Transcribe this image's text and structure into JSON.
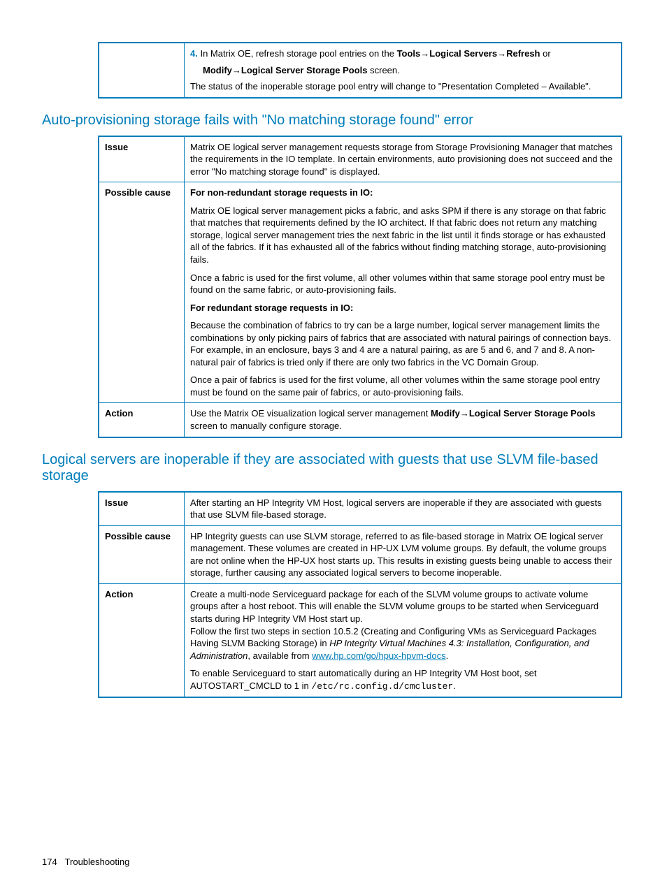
{
  "table0": {
    "step4_num": "4.",
    "step4_a": "In Matrix OE, refresh storage pool entries on the ",
    "step4_b": "Tools",
    "step4_c": "Logical Servers",
    "step4_d": "Refresh",
    "step4_e": " or ",
    "step4_f": "Modify",
    "step4_g": "Logical Server Storage Pools",
    "step4_h": " screen.",
    "step4_after": "The status of the inoperable storage pool entry will change to \"Presentation Completed – Available\"."
  },
  "heading1": "Auto-provisioning storage fails with \"No matching storage found\" error",
  "table1": {
    "issue_label": "Issue",
    "issue_text": "Matrix OE logical server management requests storage from Storage Provisioning Manager that matches the requirements in the IO template. In certain environments, auto provisioning does not succeed and the error \"No matching storage found\" is displayed.",
    "cause_label": "Possible cause",
    "cause_h1": "For non-redundant storage requests in IO:",
    "cause_p1": "Matrix OE logical server management picks a fabric, and asks SPM if there is any storage on that fabric that matches that requirements defined by the IO architect. If that fabric does not return any matching storage, logical server management tries the next fabric in the list until it finds storage or has exhausted all of the fabrics. If it has exhausted all of the fabrics without finding matching storage, auto-provisioning fails.",
    "cause_p2": "Once a fabric is used for the first volume, all other volumes within that same storage pool entry must be found on the same fabric, or auto-provisioning fails.",
    "cause_h2": "For redundant storage requests in IO:",
    "cause_p3": "Because the combination of fabrics to try can be a large number, logical server management limits the combinations by only picking pairs of fabrics that are associated with natural pairings of connection bays. For example, in an enclosure, bays 3 and 4 are a natural pairing, as are 5 and 6, and 7 and 8. A non-natural pair of fabrics is tried only if there are only two fabrics in the VC Domain Group.",
    "cause_p4": "Once a pair of fabrics is used for the first volume, all other volumes within the same storage pool entry must be found on the same pair of fabrics, or auto-provisioning fails.",
    "action_label": "Action",
    "action_a": "Use the Matrix OE visualization logical server management ",
    "action_b": "Modify",
    "action_c": "Logical Server Storage Pools",
    "action_d": " screen to manually configure storage."
  },
  "heading2": "Logical servers are inoperable if they are associated with guests that use SLVM file-based storage",
  "table2": {
    "issue_label": "Issue",
    "issue_text": "After starting an HP Integrity VM Host, logical servers are inoperable if they are associated with guests that use SLVM file-based storage.",
    "cause_label": "Possible cause",
    "cause_text": "HP Integrity guests can use SLVM storage, referred to as file-based storage in Matrix OE logical server management. These volumes are created in HP-UX LVM volume groups. By default, the volume groups are not online when the HP-UX host starts up. This results in existing guests being unable to access their storage, further causing any associated logical servers to become inoperable.",
    "action_label": "Action",
    "action_p1": "Create a multi-node Serviceguard package for each of the SLVM volume groups to activate volume groups after a host reboot. This will enable the SLVM volume groups to be started when Serviceguard starts during HP Integrity VM Host start up.",
    "action_p2a": "Follow the first two steps in section 10.5.2 (Creating and Configuring VMs as Serviceguard Packages Having SLVM Backing Storage) in ",
    "action_p2b": "HP Integrity Virtual Machines 4.3: Installation, Configuration, and Administration",
    "action_p2c": ", available from ",
    "action_link": "www.hp.com/go/hpux-hpvm-docs",
    "action_p2d": ".",
    "action_p3a": "To enable Serviceguard to start automatically during an HP Integrity VM Host boot, set AUTOSTART_CMCLD to 1 in ",
    "action_p3b": "/etc/rc.config.d/cmcluster",
    "action_p3c": "."
  },
  "footer_page": "174",
  "footer_text": "Troubleshooting",
  "arrow": "→"
}
